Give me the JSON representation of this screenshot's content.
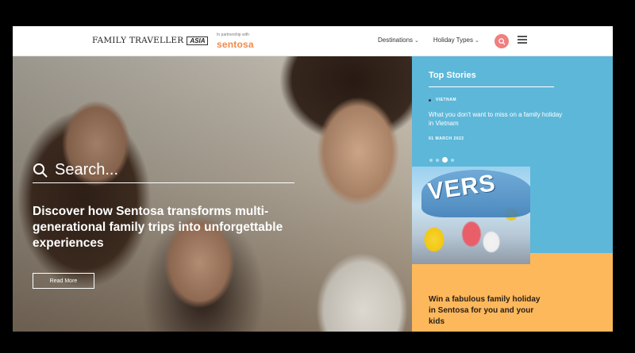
{
  "header": {
    "logo_text": "FAMILY TRAVELLER",
    "logo_badge": "ASIA",
    "partner_small": "In partnership with",
    "partner_brand": "sentosa",
    "nav": [
      {
        "label": "Destinations"
      },
      {
        "label": "Holiday Types"
      }
    ],
    "search_icon": "search-icon",
    "menu_icon": "hamburger-menu-icon",
    "accent_color": "#f07f7f"
  },
  "hero": {
    "search_placeholder": "Search...",
    "title": "Discover how Sentosa transforms multi-generational family trips into unforgettable experiences",
    "read_more": "Read More"
  },
  "sidebar": {
    "top_stories_title": "Top Stories",
    "story": {
      "category": "VIETNAM",
      "headline": "What you don't want to miss on a family holiday in Vietnam",
      "date": "01 MARCH 2022"
    },
    "carousel": {
      "total": 4,
      "active_index": 2
    },
    "promo_image_text": "VERS",
    "promo_title": "Win a fabulous family holiday in Sentosa for you and your kids",
    "colors": {
      "stories_bg": "#5db7d9",
      "promo_bg": "#fdb85c"
    }
  }
}
